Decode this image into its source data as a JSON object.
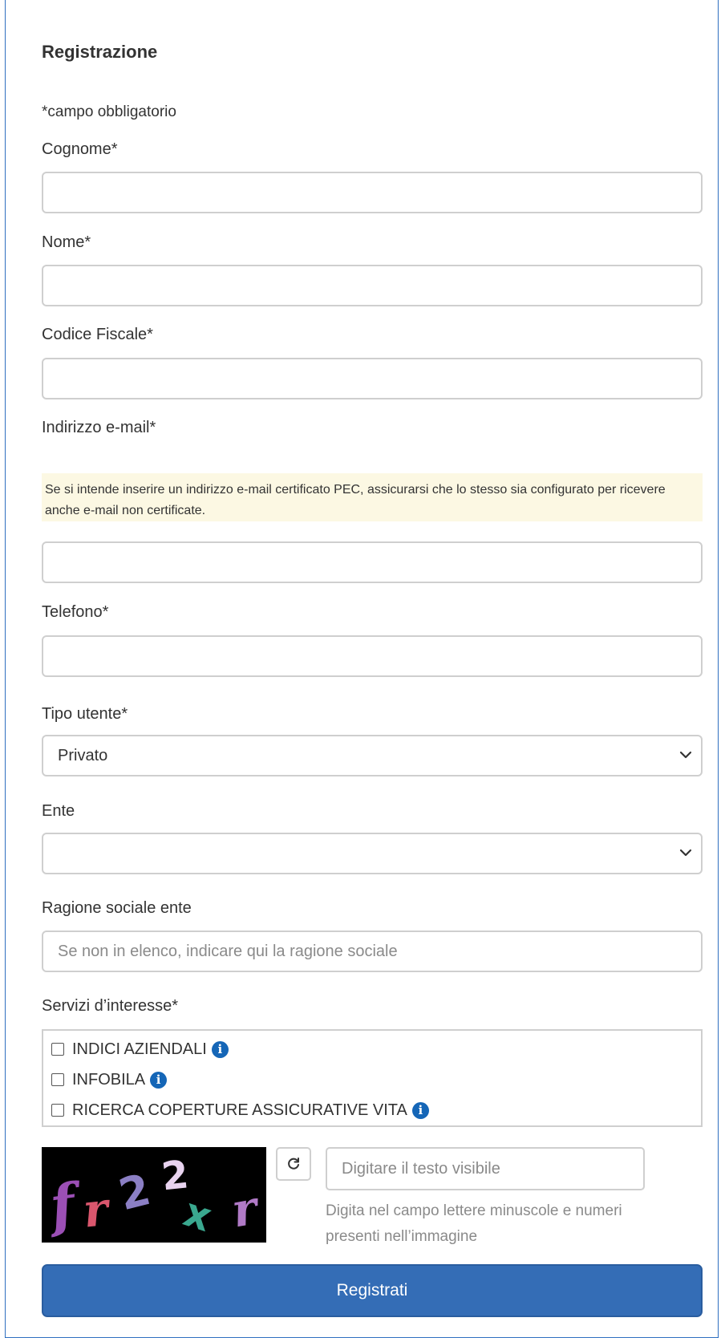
{
  "form": {
    "title": "Registrazione",
    "required_note": "*campo obbligatorio",
    "cognome": {
      "label": "Cognome*",
      "value": ""
    },
    "nome": {
      "label": "Nome*",
      "value": ""
    },
    "codice_fiscale": {
      "label": "Codice Fiscale*",
      "value": ""
    },
    "email": {
      "label": "Indirizzo e-mail*",
      "warning": "Se si intende inserire un indirizzo e-mail certificato PEC, assicurarsi che lo stesso sia configurato per ricevere anche e-mail non certificate.",
      "value": ""
    },
    "telefono": {
      "label": "Telefono*",
      "value": ""
    },
    "tipo_utente": {
      "label": "Tipo utente*",
      "selected": "Privato"
    },
    "ente": {
      "label": "Ente",
      "selected": ""
    },
    "ragione_sociale": {
      "label": "Ragione sociale ente",
      "placeholder": "Se non in elenco, indicare qui la ragione sociale",
      "value": ""
    },
    "servizi": {
      "label": "Servizi d’interesse*",
      "items": [
        {
          "label": "INDICI AZIENDALI",
          "checked": false
        },
        {
          "label": "INFOBILA",
          "checked": false
        },
        {
          "label": "RICERCA COPERTURE ASSICURATIVE VITA",
          "checked": false
        }
      ]
    },
    "captcha": {
      "text": "fr2x r",
      "input_placeholder": "Digitare il testo visibile",
      "help": "Digita nel campo lettere minuscole e numeri presenti nell’immagine"
    },
    "submit_label": "Registrati"
  },
  "colors": {
    "primary_button": "#346db6",
    "info_icon": "#1566b7",
    "warning_bg": "#fcf8e3",
    "panel_border": "#2f6fc0"
  },
  "icons": {
    "select_arrow": "chevron-down-icon",
    "info": "info-icon",
    "refresh": "refresh-icon"
  }
}
